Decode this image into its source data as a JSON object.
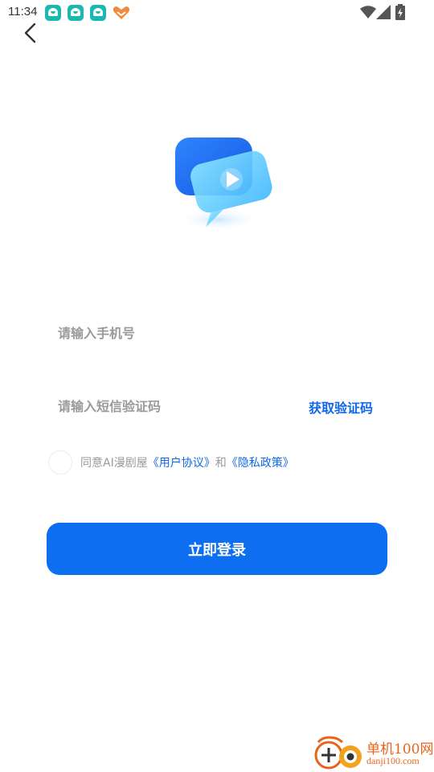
{
  "status_bar": {
    "time": "11:34",
    "notification_icons": [
      "app-notification-icon",
      "app-notification-icon",
      "app-notification-icon",
      "heart-app-icon"
    ],
    "system_icons": [
      "wifi-icon",
      "cellular-signal-icon",
      "battery-charging-icon"
    ]
  },
  "nav": {
    "back_icon": "chevron-left-icon"
  },
  "logo": {
    "icon": "video-play-logo-icon"
  },
  "form": {
    "phone_placeholder": "请输入手机号",
    "phone_value": "",
    "code_placeholder": "请输入短信验证码",
    "code_value": "",
    "get_code_label": "获取验证码"
  },
  "agreement": {
    "checked": false,
    "prefix": "同意AI漫剧屋",
    "user_agreement": "《用户协议》",
    "conjunction": "和",
    "privacy_policy": "《隐私政策》"
  },
  "login_button_label": "立即登录",
  "watermark": {
    "name_cn": "单机100网",
    "domain": "danji100.com"
  },
  "colors": {
    "accent": "#0d6ef2",
    "link": "#1169e8",
    "placeholder": "#9a9a9a",
    "background": "#ffffff",
    "watermark": "#e8641c"
  }
}
